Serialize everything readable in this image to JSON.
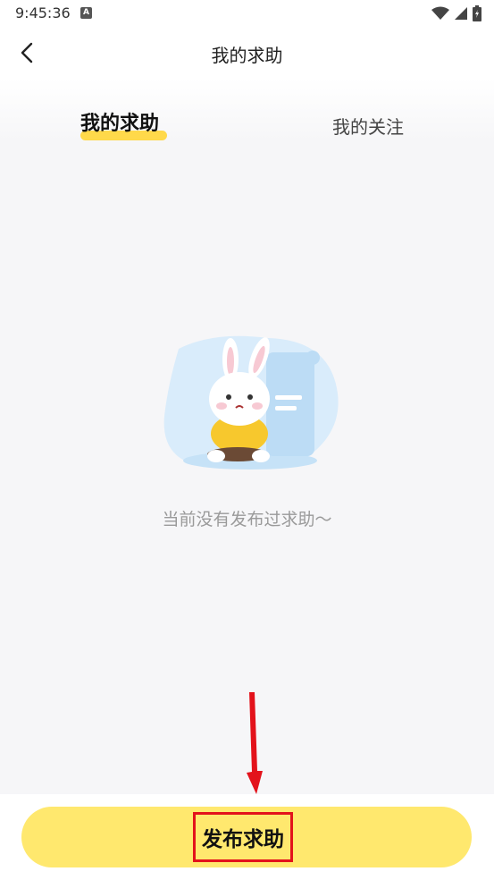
{
  "status_bar": {
    "time": "9:45:36",
    "notification_badge": "A"
  },
  "nav": {
    "title": "我的求助",
    "back_icon": "chevron-left-icon"
  },
  "tabs": [
    {
      "label": "我的求助",
      "active": true
    },
    {
      "label": "我的关注",
      "active": false
    }
  ],
  "empty_state": {
    "message": "当前没有发布过求助～",
    "illustration": "bunny-empty-icon"
  },
  "bottom": {
    "publish_label": "发布求助"
  },
  "colors": {
    "accent": "#ffd94a",
    "button": "#ffe86e",
    "highlight": "#e3121b"
  }
}
